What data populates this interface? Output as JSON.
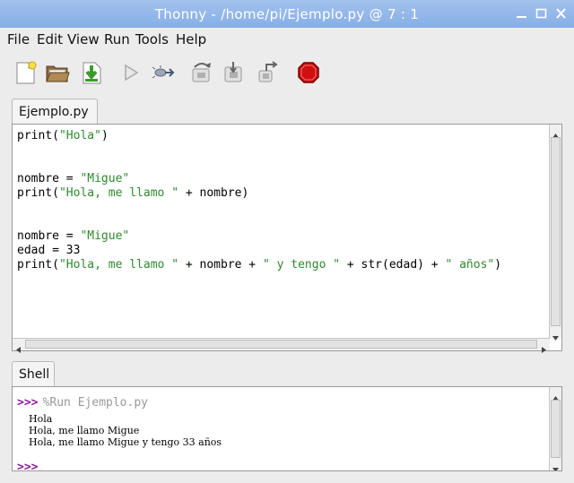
{
  "window": {
    "title": "Thonny  -  /home/pi/Ejemplo.py  @  7 : 1"
  },
  "menu": [
    "File",
    "Edit",
    "View",
    "Run",
    "Tools",
    "Help"
  ],
  "toolbar": [
    {
      "name": "new-file-icon"
    },
    {
      "name": "open-file-icon"
    },
    {
      "name": "save-file-icon"
    },
    {
      "name": "run-icon"
    },
    {
      "name": "debug-icon"
    },
    {
      "name": "step-over-icon"
    },
    {
      "name": "step-into-icon"
    },
    {
      "name": "step-out-icon"
    },
    {
      "name": "stop-icon"
    }
  ],
  "editor": {
    "tab_label": "Ejemplo.py",
    "lines": [
      [
        {
          "t": "print("
        },
        {
          "t": "\"Hola\"",
          "s": 1
        },
        {
          "t": ")"
        }
      ],
      [],
      [],
      [
        {
          "t": "nombre = "
        },
        {
          "t": "\"Migue\"",
          "s": 1
        }
      ],
      [
        {
          "t": "print("
        },
        {
          "t": "\"Hola, me llamo \"",
          "s": 1
        },
        {
          "t": " + nombre)"
        }
      ],
      [],
      [],
      [
        {
          "t": "nombre = "
        },
        {
          "t": "\"Migue\"",
          "s": 1
        }
      ],
      [
        {
          "t": "edad = 33"
        }
      ],
      [
        {
          "t": "print("
        },
        {
          "t": "\"Hola, me llamo \"",
          "s": 1
        },
        {
          "t": " + nombre + "
        },
        {
          "t": "\" y tengo \"",
          "s": 1
        },
        {
          "t": " + str(edad) + "
        },
        {
          "t": "\" años\"",
          "s": 1
        },
        {
          "t": ")"
        }
      ]
    ]
  },
  "shell": {
    "tab_label": "Shell",
    "prompt": ">>>",
    "run_command": "%Run Ejemplo.py",
    "output": [
      "Hola",
      "Hola, me llamo Migue",
      "Hola, me llamo Migue y tengo 33 años"
    ]
  },
  "colors": {
    "string": "#2d8a2d",
    "prompt": "#8b1a9b",
    "stop": "#d01010",
    "titlebar": "#92b6ea"
  }
}
